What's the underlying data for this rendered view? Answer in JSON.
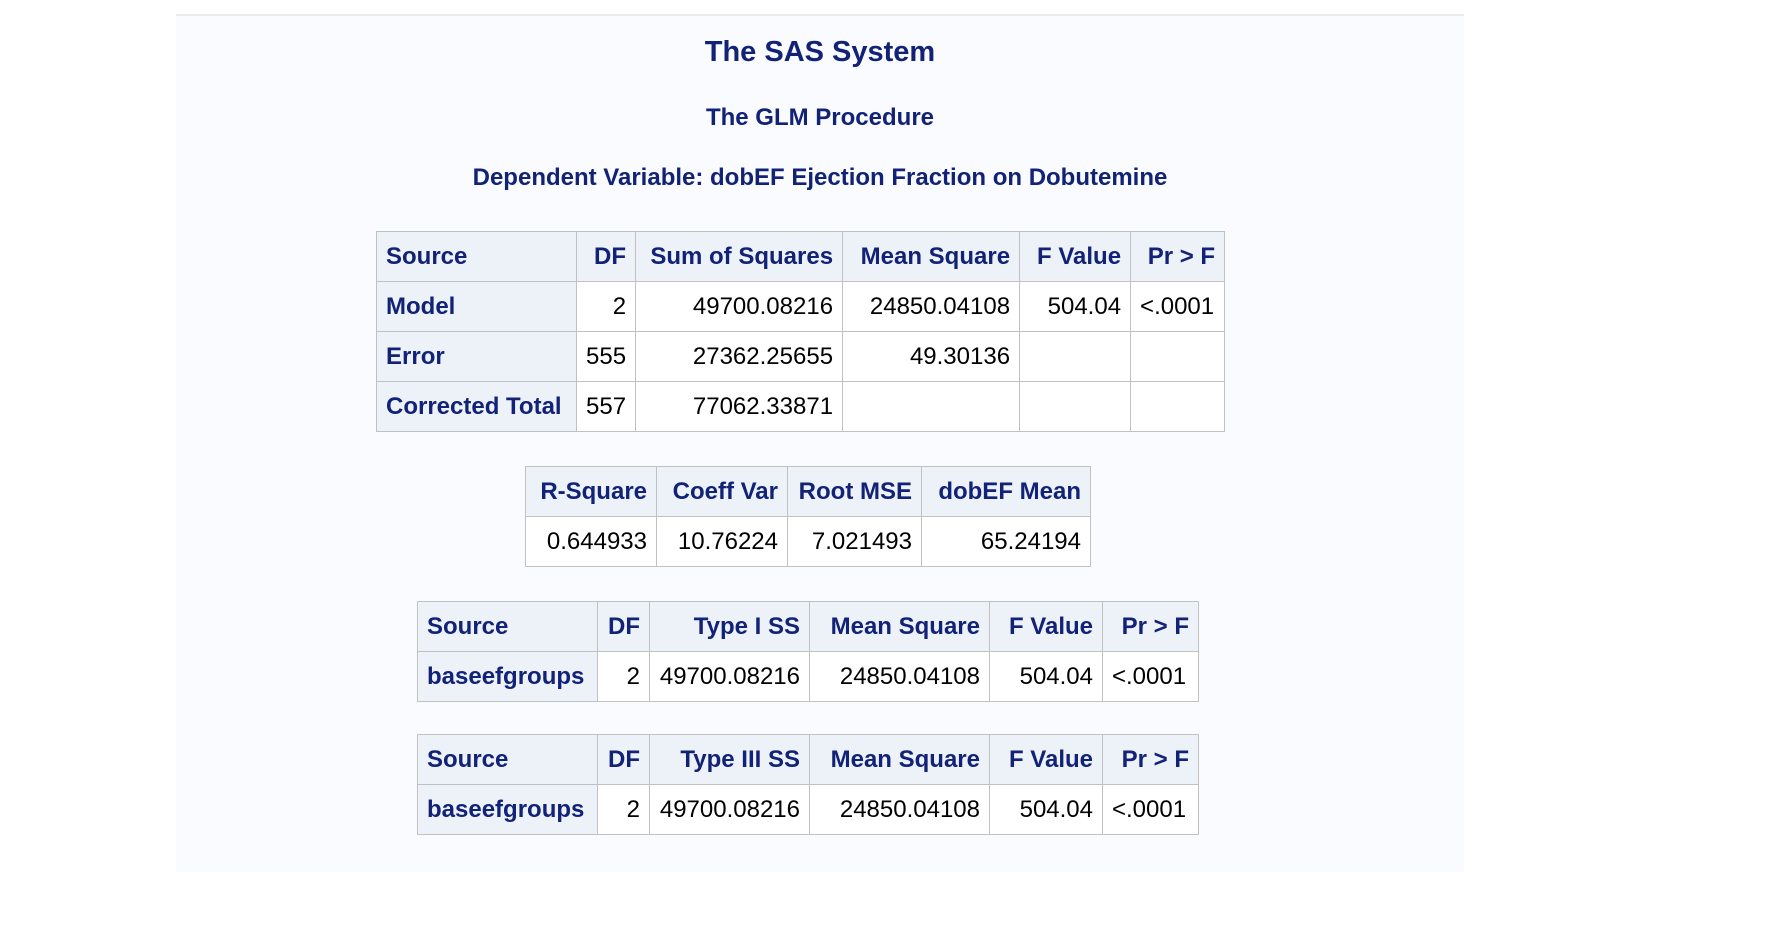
{
  "title": "The SAS System",
  "procedure": "The GLM Procedure",
  "dependent_variable": "Dependent Variable: dobEF Ejection Fraction on Dobutemine",
  "anova": {
    "headers": [
      "Source",
      "DF",
      "Sum of Squares",
      "Mean Square",
      "F Value",
      "Pr > F"
    ],
    "rows": [
      {
        "source": "Model",
        "df": "2",
        "ss": "49700.08216",
        "ms": "24850.04108",
        "f": "504.04",
        "p": "<.0001"
      },
      {
        "source": "Error",
        "df": "555",
        "ss": "27362.25655",
        "ms": "49.30136",
        "f": "",
        "p": ""
      },
      {
        "source": "Corrected Total",
        "df": "557",
        "ss": "77062.33871",
        "ms": "",
        "f": "",
        "p": ""
      }
    ]
  },
  "fit": {
    "headers": [
      "R-Square",
      "Coeff Var",
      "Root MSE",
      "dobEF Mean"
    ],
    "values": [
      "0.644933",
      "10.76224",
      "7.021493",
      "65.24194"
    ]
  },
  "type1": {
    "headers": [
      "Source",
      "DF",
      "Type I SS",
      "Mean Square",
      "F Value",
      "Pr > F"
    ],
    "row": {
      "source": "baseefgroups",
      "df": "2",
      "ss": "49700.08216",
      "ms": "24850.04108",
      "f": "504.04",
      "p": "<.0001"
    }
  },
  "type3": {
    "headers": [
      "Source",
      "DF",
      "Type III SS",
      "Mean Square",
      "F Value",
      "Pr > F"
    ],
    "row": {
      "source": "baseefgroups",
      "df": "2",
      "ss": "49700.08216",
      "ms": "24850.04108",
      "f": "504.04",
      "p": "<.0001"
    }
  },
  "colors": {
    "header_text": "#112277",
    "header_bg": "#edf2f9",
    "panel_bg": "#fafbfe",
    "border": "#c1c1c1"
  }
}
